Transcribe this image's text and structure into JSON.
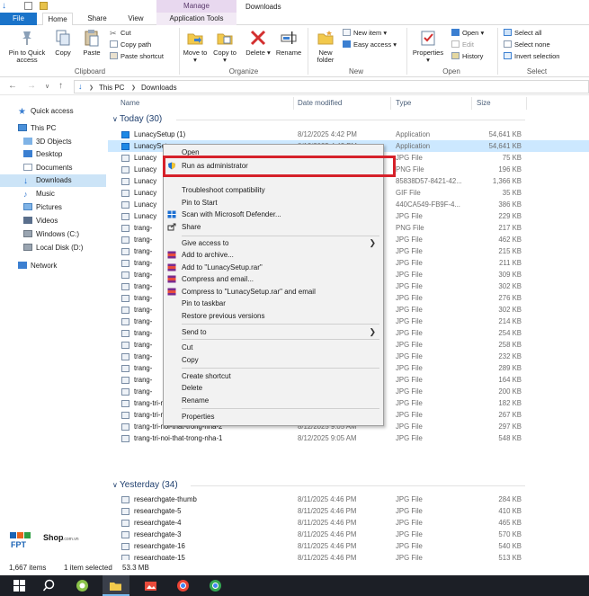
{
  "window": {
    "manage_tab": "Manage",
    "title": "Downloads"
  },
  "tabs": {
    "file": "File",
    "home": "Home",
    "share": "Share",
    "view": "View",
    "application_tools": "Application Tools"
  },
  "ribbon": {
    "clipboard": {
      "title": "Clipboard",
      "pin_quick_access": "Pin to Quick access",
      "copy": "Copy",
      "paste": "Paste",
      "cut": "Cut",
      "copy_path": "Copy path",
      "paste_shortcut": "Paste shortcut"
    },
    "organize": {
      "title": "Organize",
      "move_to": "Move to",
      "copy_to": "Copy to",
      "delete": "Delete",
      "rename": "Rename"
    },
    "new": {
      "title": "New",
      "new_folder": "New folder",
      "new_item": "New item",
      "easy_access": "Easy access"
    },
    "open": {
      "title": "Open",
      "properties": "Properties",
      "open": "Open",
      "edit": "Edit",
      "history": "History"
    },
    "select": {
      "title": "Select",
      "select_all": "Select all",
      "select_none": "Select none",
      "invert_selection": "Invert selection"
    }
  },
  "address": {
    "this_pc": "This PC",
    "downloads": "Downloads"
  },
  "nav": {
    "quick_access": "Quick access",
    "this_pc": "This PC",
    "objects_3d": "3D Objects",
    "desktop": "Desktop",
    "documents": "Documents",
    "downloads": "Downloads",
    "music": "Music",
    "pictures": "Pictures",
    "videos": "Videos",
    "windows_c": "Windows (C:)",
    "local_d": "Local Disk (D:)",
    "network": "Network"
  },
  "columns": {
    "name": "Name",
    "date": "Date modified",
    "type": "Type",
    "size": "Size"
  },
  "groups": {
    "today": "Today (30)",
    "yesterday": "Yesterday (34)"
  },
  "files_today": [
    {
      "name": "LunacySetup (1)",
      "date": "8/12/2025 4:42 PM",
      "type": "Application",
      "size": "54,641 KB"
    },
    {
      "name": "LunacySetup",
      "date": "8/12/2025 4:42 PM",
      "type": "Application",
      "size": "54,641 KB"
    },
    {
      "name": "Lunacy",
      "date": "",
      "type": "JPG File",
      "size": "75 KB"
    },
    {
      "name": "Lunacy",
      "date": "",
      "type": "PNG File",
      "size": "196 KB"
    },
    {
      "name": "Lunacy",
      "date": "",
      "type": "85838D57-8421-42...",
      "size": "1,366 KB"
    },
    {
      "name": "Lunacy",
      "date": "",
      "type": "GIF File",
      "size": "35 KB"
    },
    {
      "name": "Lunacy",
      "date": "",
      "type": "440CA549-FB9F-4...",
      "size": "386 KB"
    },
    {
      "name": "Lunacy",
      "date": "",
      "type": "JPG File",
      "size": "229 KB"
    },
    {
      "name": "trang-",
      "date": "",
      "type": "PNG File",
      "size": "217 KB"
    },
    {
      "name": "trang-",
      "date": "",
      "type": "JPG File",
      "size": "462 KB"
    },
    {
      "name": "trang-",
      "date": "",
      "type": "JPG File",
      "size": "215 KB"
    },
    {
      "name": "trang-",
      "date": "",
      "type": "JPG File",
      "size": "211 KB"
    },
    {
      "name": "trang-",
      "date": "",
      "type": "JPG File",
      "size": "309 KB"
    },
    {
      "name": "trang-",
      "date": "",
      "type": "JPG File",
      "size": "302 KB"
    },
    {
      "name": "trang-",
      "date": "",
      "type": "JPG File",
      "size": "276 KB"
    },
    {
      "name": "trang-",
      "date": "",
      "type": "JPG File",
      "size": "302 KB"
    },
    {
      "name": "trang-",
      "date": "",
      "type": "JPG File",
      "size": "214 KB"
    },
    {
      "name": "trang-",
      "date": "",
      "type": "JPG File",
      "size": "254 KB"
    },
    {
      "name": "trang-",
      "date": "",
      "type": "JPG File",
      "size": "258 KB"
    },
    {
      "name": "trang-",
      "date": "",
      "type": "JPG File",
      "size": "232 KB"
    },
    {
      "name": "trang-",
      "date": "",
      "type": "JPG File",
      "size": "289 KB"
    },
    {
      "name": "trang-",
      "date": "",
      "type": "JPG File",
      "size": "164 KB"
    },
    {
      "name": "trang-",
      "date": "",
      "type": "JPG File",
      "size": "200 KB"
    },
    {
      "name": "trang-tri-noi-that-trong-nha-4",
      "date": "8/12/2025 9:05 AM",
      "type": "JPG File",
      "size": "182 KB"
    },
    {
      "name": "trang-tri-noi-that-trong-nha-3",
      "date": "8/12/2025 9:05 AM",
      "type": "JPG File",
      "size": "267 KB"
    },
    {
      "name": "trang-tri-noi-that-trong-nha-2",
      "date": "8/12/2025 9:05 AM",
      "type": "JPG File",
      "size": "297 KB"
    },
    {
      "name": "trang-tri-noi-that-trong-nha-1",
      "date": "8/12/2025 9:05 AM",
      "type": "JPG File",
      "size": "548 KB"
    }
  ],
  "files_yesterday": [
    {
      "name": "researchgate-thumb",
      "date": "8/11/2025 4:46 PM",
      "type": "JPG File",
      "size": "284 KB"
    },
    {
      "name": "researchgate-5",
      "date": "8/11/2025 4:46 PM",
      "type": "JPG File",
      "size": "410 KB"
    },
    {
      "name": "researchgate-4",
      "date": "8/11/2025 4:46 PM",
      "type": "JPG File",
      "size": "465 KB"
    },
    {
      "name": "researchgate-3",
      "date": "8/11/2025 4:46 PM",
      "type": "JPG File",
      "size": "570 KB"
    },
    {
      "name": "researchgate-16",
      "date": "8/11/2025 4:46 PM",
      "type": "JPG File",
      "size": "540 KB"
    },
    {
      "name": "researchgate-15",
      "date": "8/11/2025 4:46 PM",
      "type": "JPG File",
      "size": "513 KB"
    }
  ],
  "context_menu": {
    "open": "Open",
    "run_as_admin": "Run as administrator",
    "troubleshoot": "Troubleshoot compatibility",
    "pin_start": "Pin to Start",
    "scan_defender": "Scan with Microsoft Defender...",
    "share": "Share",
    "give_access": "Give access to",
    "add_archive": "Add to archive...",
    "add_rar": "Add to \"LunacySetup.rar\"",
    "compress_email": "Compress and email...",
    "compress_rar_email": "Compress to \"LunacySetup.rar\" and email",
    "pin_taskbar": "Pin to taskbar",
    "restore_versions": "Restore previous versions",
    "send_to": "Send to",
    "cut": "Cut",
    "copy": "Copy",
    "create_shortcut": "Create shortcut",
    "delete": "Delete",
    "rename": "Rename",
    "properties": "Properties"
  },
  "status": {
    "items": "1,667 items",
    "selected": "1 item selected",
    "size": "53.3 MB"
  },
  "watermark": {
    "brand": "FPT",
    "shop": "Shop",
    "domain": ".com.vn"
  },
  "colors": {
    "accent": "#1a73c9",
    "selection": "#cce8ff",
    "highlight_box": "#d6212a",
    "manage_tab": "#e8d8ef"
  }
}
